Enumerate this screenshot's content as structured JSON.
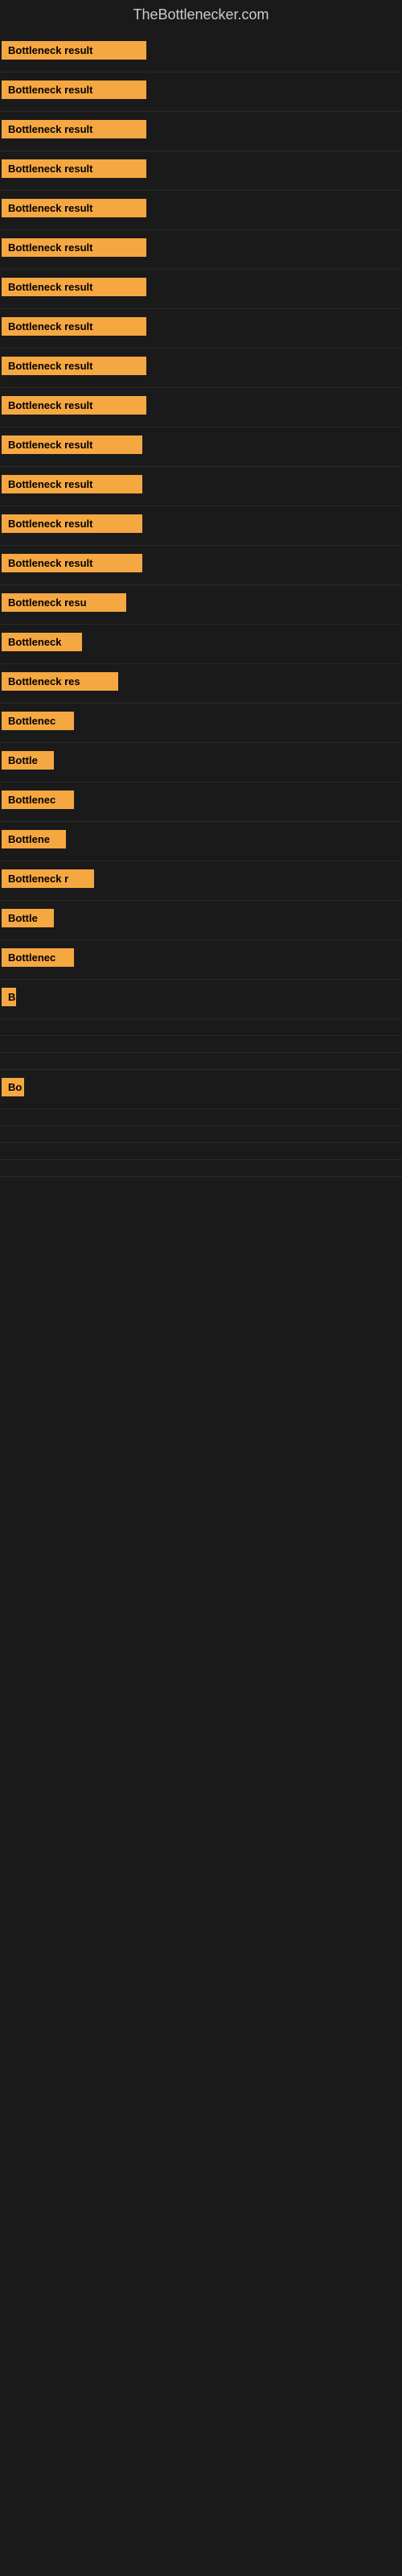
{
  "site": {
    "title": "TheBottlenecker.com"
  },
  "rows": [
    {
      "id": 1,
      "label": "Bottleneck result",
      "width": 180
    },
    {
      "id": 2,
      "label": "Bottleneck result",
      "width": 180
    },
    {
      "id": 3,
      "label": "Bottleneck result",
      "width": 180
    },
    {
      "id": 4,
      "label": "Bottleneck result",
      "width": 180
    },
    {
      "id": 5,
      "label": "Bottleneck result",
      "width": 180
    },
    {
      "id": 6,
      "label": "Bottleneck result",
      "width": 180
    },
    {
      "id": 7,
      "label": "Bottleneck result",
      "width": 180
    },
    {
      "id": 8,
      "label": "Bottleneck result",
      "width": 180
    },
    {
      "id": 9,
      "label": "Bottleneck result",
      "width": 180
    },
    {
      "id": 10,
      "label": "Bottleneck result",
      "width": 180
    },
    {
      "id": 11,
      "label": "Bottleneck result",
      "width": 175
    },
    {
      "id": 12,
      "label": "Bottleneck result",
      "width": 175
    },
    {
      "id": 13,
      "label": "Bottleneck result",
      "width": 175
    },
    {
      "id": 14,
      "label": "Bottleneck result",
      "width": 175
    },
    {
      "id": 15,
      "label": "Bottleneck resu",
      "width": 155
    },
    {
      "id": 16,
      "label": "Bottleneck",
      "width": 100
    },
    {
      "id": 17,
      "label": "Bottleneck res",
      "width": 145
    },
    {
      "id": 18,
      "label": "Bottlenec",
      "width": 90
    },
    {
      "id": 19,
      "label": "Bottle",
      "width": 65
    },
    {
      "id": 20,
      "label": "Bottlenec",
      "width": 90
    },
    {
      "id": 21,
      "label": "Bottlene",
      "width": 80
    },
    {
      "id": 22,
      "label": "Bottleneck r",
      "width": 115
    },
    {
      "id": 23,
      "label": "Bottle",
      "width": 65
    },
    {
      "id": 24,
      "label": "Bottlenec",
      "width": 90
    },
    {
      "id": 25,
      "label": "B",
      "width": 18
    },
    {
      "id": 26,
      "label": "",
      "width": 0
    },
    {
      "id": 27,
      "label": "",
      "width": 0
    },
    {
      "id": 28,
      "label": "",
      "width": 0
    },
    {
      "id": 29,
      "label": "Bo",
      "width": 28
    },
    {
      "id": 30,
      "label": "",
      "width": 0
    },
    {
      "id": 31,
      "label": "",
      "width": 0
    },
    {
      "id": 32,
      "label": "",
      "width": 0
    },
    {
      "id": 33,
      "label": "",
      "width": 0
    }
  ],
  "colors": {
    "bar_bg": "#f5a742",
    "bar_text": "#000000",
    "background": "#1a1a1a",
    "title": "#cccccc"
  }
}
